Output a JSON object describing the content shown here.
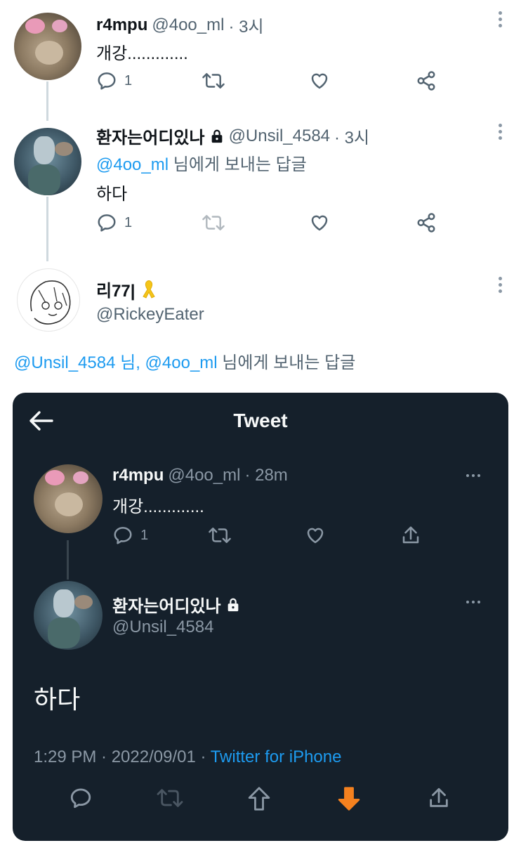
{
  "tweets": [
    {
      "name": "r4mpu",
      "handle": "@4oo_ml",
      "time": "· 3시",
      "text": "개강.............",
      "reply_count": "1"
    },
    {
      "name": "환자는어디있나",
      "handle": "@Unsil_4584",
      "time": "· 3시",
      "reply_to_handle": "@4oo_ml",
      "reply_to_suffix": "님에게 보내는 답글",
      "text": "하다",
      "reply_count": "1"
    },
    {
      "name": "리77|",
      "handle": "@RickeyEater"
    }
  ],
  "reply_line": {
    "handle1": "@Unsil_4584",
    "mid": "님,",
    "handle2": "@4oo_ml",
    "suffix": "님에게 보내는 답글"
  },
  "dark_card": {
    "title": "Tweet",
    "tweet1": {
      "name": "r4mpu",
      "handle": "@4oo_ml",
      "time": "· 28m",
      "text": "개강.............",
      "reply_count": "1"
    },
    "tweet2": {
      "name": "환자는어디있나",
      "handle": "@Unsil_4584",
      "text": "하다"
    },
    "timestamp": "1:29 PM · 2022/09/01 · ",
    "client": "Twitter for iPhone"
  },
  "colors": {
    "accent": "#1d9bf0",
    "dark_bg": "#15202b",
    "downvote": "#f4811f"
  },
  "icons": [
    "reply-icon",
    "retweet-icon",
    "like-icon",
    "share-icon",
    "lock-icon",
    "ribbon-icon",
    "back-arrow-icon",
    "upvote-icon",
    "downvote-icon",
    "more-icon"
  ]
}
